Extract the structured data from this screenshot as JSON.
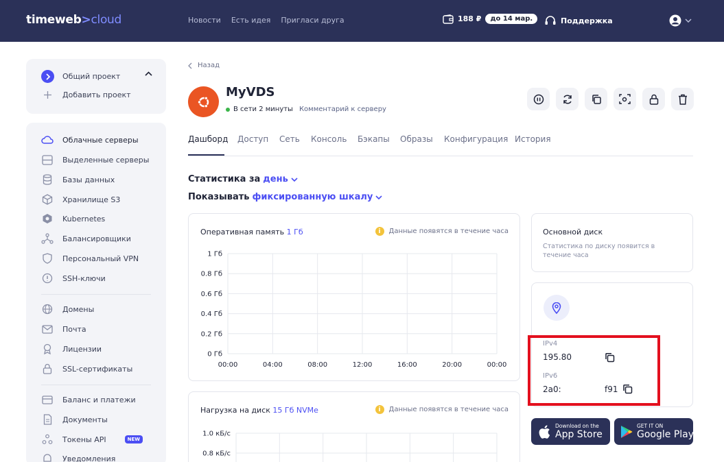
{
  "header": {
    "logo_main": "timeweb",
    "logo_arrow": ">",
    "logo_sub": "cloud",
    "nav": [
      {
        "label": "Новости"
      },
      {
        "label": "Есть идея"
      },
      {
        "label": "Пригласи друга"
      }
    ],
    "balance": "188 ₽",
    "balance_until": "до 14 мар.",
    "support": "Поддержка"
  },
  "project": {
    "current": "Общий проект",
    "add": "Добавить проект"
  },
  "sidebar": {
    "items": [
      {
        "label": "Облачные серверы",
        "icon": "cloud-icon",
        "active": true
      },
      {
        "label": "Выделенные серверы",
        "icon": "server-icon"
      },
      {
        "label": "Базы данных",
        "icon": "database-icon"
      },
      {
        "label": "Хранилище S3",
        "icon": "cube-icon"
      },
      {
        "label": "Kubernetes",
        "icon": "kubernetes-icon"
      },
      {
        "label": "Балансировщики",
        "icon": "balancer-icon"
      },
      {
        "label": "Персональный VPN",
        "icon": "shield-icon"
      },
      {
        "label": "SSH-ключи",
        "icon": "key-icon"
      },
      {
        "label": "Домены",
        "icon": "globe-icon"
      },
      {
        "label": "Почта",
        "icon": "mail-icon"
      },
      {
        "label": "Лицензии",
        "icon": "license-icon"
      },
      {
        "label": "SSL-сертификаты",
        "icon": "lock-icon"
      },
      {
        "label": "Баланс и платежи",
        "icon": "card-icon"
      },
      {
        "label": "Документы",
        "icon": "document-icon"
      },
      {
        "label": "Токены API",
        "icon": "api-icon",
        "badge": "NEW"
      },
      {
        "label": "Уведомления",
        "icon": "bell-icon"
      }
    ]
  },
  "server": {
    "back": "Назад",
    "name": "MyVDS",
    "status": "В сети 2 минуты",
    "comment": "Комментарий к серверу",
    "os_icon": "ubuntu-icon"
  },
  "tabs": [
    {
      "label": "Дашборд",
      "active": true
    },
    {
      "label": "Доступ"
    },
    {
      "label": "Сеть"
    },
    {
      "label": "Консоль"
    },
    {
      "label": "Бэкапы"
    },
    {
      "label": "Образы"
    },
    {
      "label": "Конфигурация"
    },
    {
      "label": "История"
    }
  ],
  "stats": {
    "period_prefix": "Статистика за",
    "period_value": "день",
    "scale_prefix": "Показывать",
    "scale_value": "фиксированную шкалу"
  },
  "ram_panel": {
    "title": "Оперативная память",
    "title_value": "1 Гб",
    "note": "Данные появятся в течение часа"
  },
  "disk_panel": {
    "title": "Нагрузка на диск",
    "title_value": "15 Гб NVMe",
    "note": "Данные появятся в течение часа"
  },
  "main_disk": {
    "title": "Основной диск",
    "note": "Статистика по диску появится в течение часа"
  },
  "network": {
    "ipv4_label": "IPv4",
    "ipv4_value": "195.80",
    "ipv6_label": "IPv6",
    "ipv6_value_start": "2a0:",
    "ipv6_value_end": "f91"
  },
  "stores": {
    "apple_small": "Download on the",
    "apple_big": "App Store",
    "google_small": "GET IT ON",
    "google_big": "Google Play"
  },
  "chart_data": [
    {
      "type": "line",
      "title": "",
      "x": [
        "00:00",
        "04:00",
        "08:00",
        "12:00",
        "16:00",
        "20:00",
        "00:00"
      ],
      "y_ticks": [
        "1 Гб",
        "0.8 Гб",
        "0.6 Гб",
        "0.4 Гб",
        "0.2 Гб",
        "0 Гб"
      ],
      "ylim": [
        0,
        1
      ],
      "series": [],
      "grid": true
    },
    {
      "type": "line",
      "title": "",
      "y_ticks": [
        "1.0 кБ/с",
        "0.8 кБ/с"
      ],
      "series": [],
      "grid": true
    }
  ],
  "colors": {
    "header_bg": "#2b3158",
    "accent": "#4b4ef3",
    "server_icon_bg": "#ea5523",
    "online": "#3bb54a",
    "highlight": "#e3101e"
  }
}
